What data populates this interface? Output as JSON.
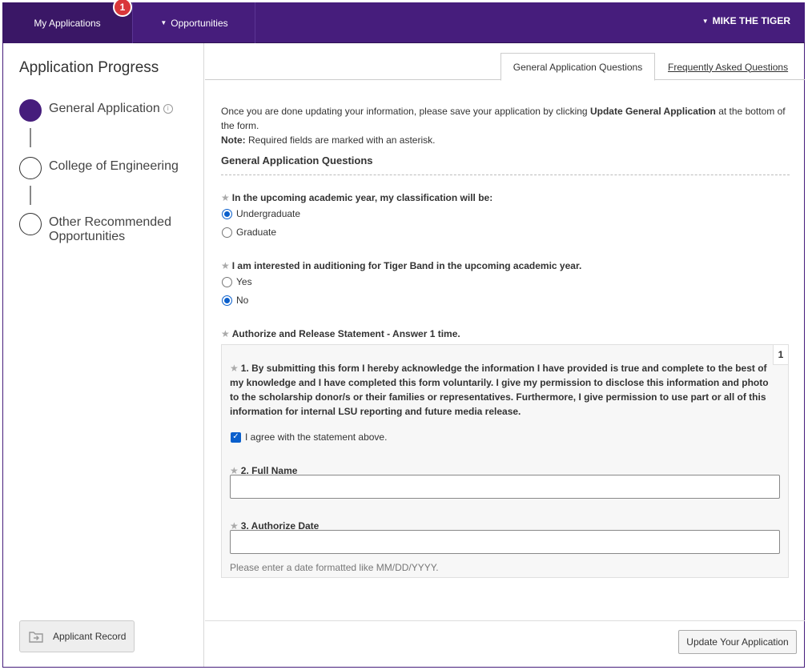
{
  "nav": {
    "my_applications": "My Applications",
    "badge_count": "1",
    "opportunities": "Opportunities",
    "user_name": "MIKE THE TIGER",
    "accent_color": "#461d7c",
    "badge_color": "#d9373a"
  },
  "sidebar": {
    "title": "Application Progress",
    "steps": [
      {
        "label": "General Application",
        "status": "current"
      },
      {
        "label": "College of Engineering",
        "status": "pending"
      },
      {
        "label": "Other Recommended Opportunities",
        "status": "pending"
      }
    ],
    "record_button": "Applicant Record"
  },
  "tabs": {
    "general": "General Application Questions",
    "faq": "Frequently Asked Questions"
  },
  "intro": {
    "line_pre": "Once you are done updating your information, please save your application by clicking ",
    "line_bold": "Update General Application",
    "line_post": " at the bottom of the form.",
    "note_label": "Note:",
    "note_text": " Required fields are marked with an asterisk."
  },
  "section_title": "General Application Questions",
  "questions": {
    "classification": {
      "label": "In the upcoming academic year, my classification will be:",
      "options": [
        "Undergraduate",
        "Graduate"
      ],
      "selected": "Undergraduate"
    },
    "tiger_band": {
      "label": "I am interested in auditioning for Tiger Band in the upcoming academic year.",
      "options": [
        "Yes",
        "No"
      ],
      "selected": "No"
    },
    "authorize": {
      "label": "Authorize and Release Statement - Answer 1 time.",
      "group_number": "1",
      "statement": "1. By submitting this form I hereby acknowledge the information I have provided is true and complete to the best of my knowledge and I have completed this form voluntarily. I give my permission to disclose this information and photo to the scholarship donor/s or their families or representatives. Furthermore, I give permission to use part or all of this information for internal LSU reporting and future media release.",
      "agree_label": "I agree with the statement above.",
      "agree_checked": true,
      "full_name_label": "2. Full Name",
      "full_name_value": "",
      "date_label": "3. Authorize Date",
      "date_value": "",
      "date_hint": "Please enter a date formatted like MM/DD/YYYY."
    }
  },
  "footer": {
    "update_button": "Update Your Application"
  }
}
